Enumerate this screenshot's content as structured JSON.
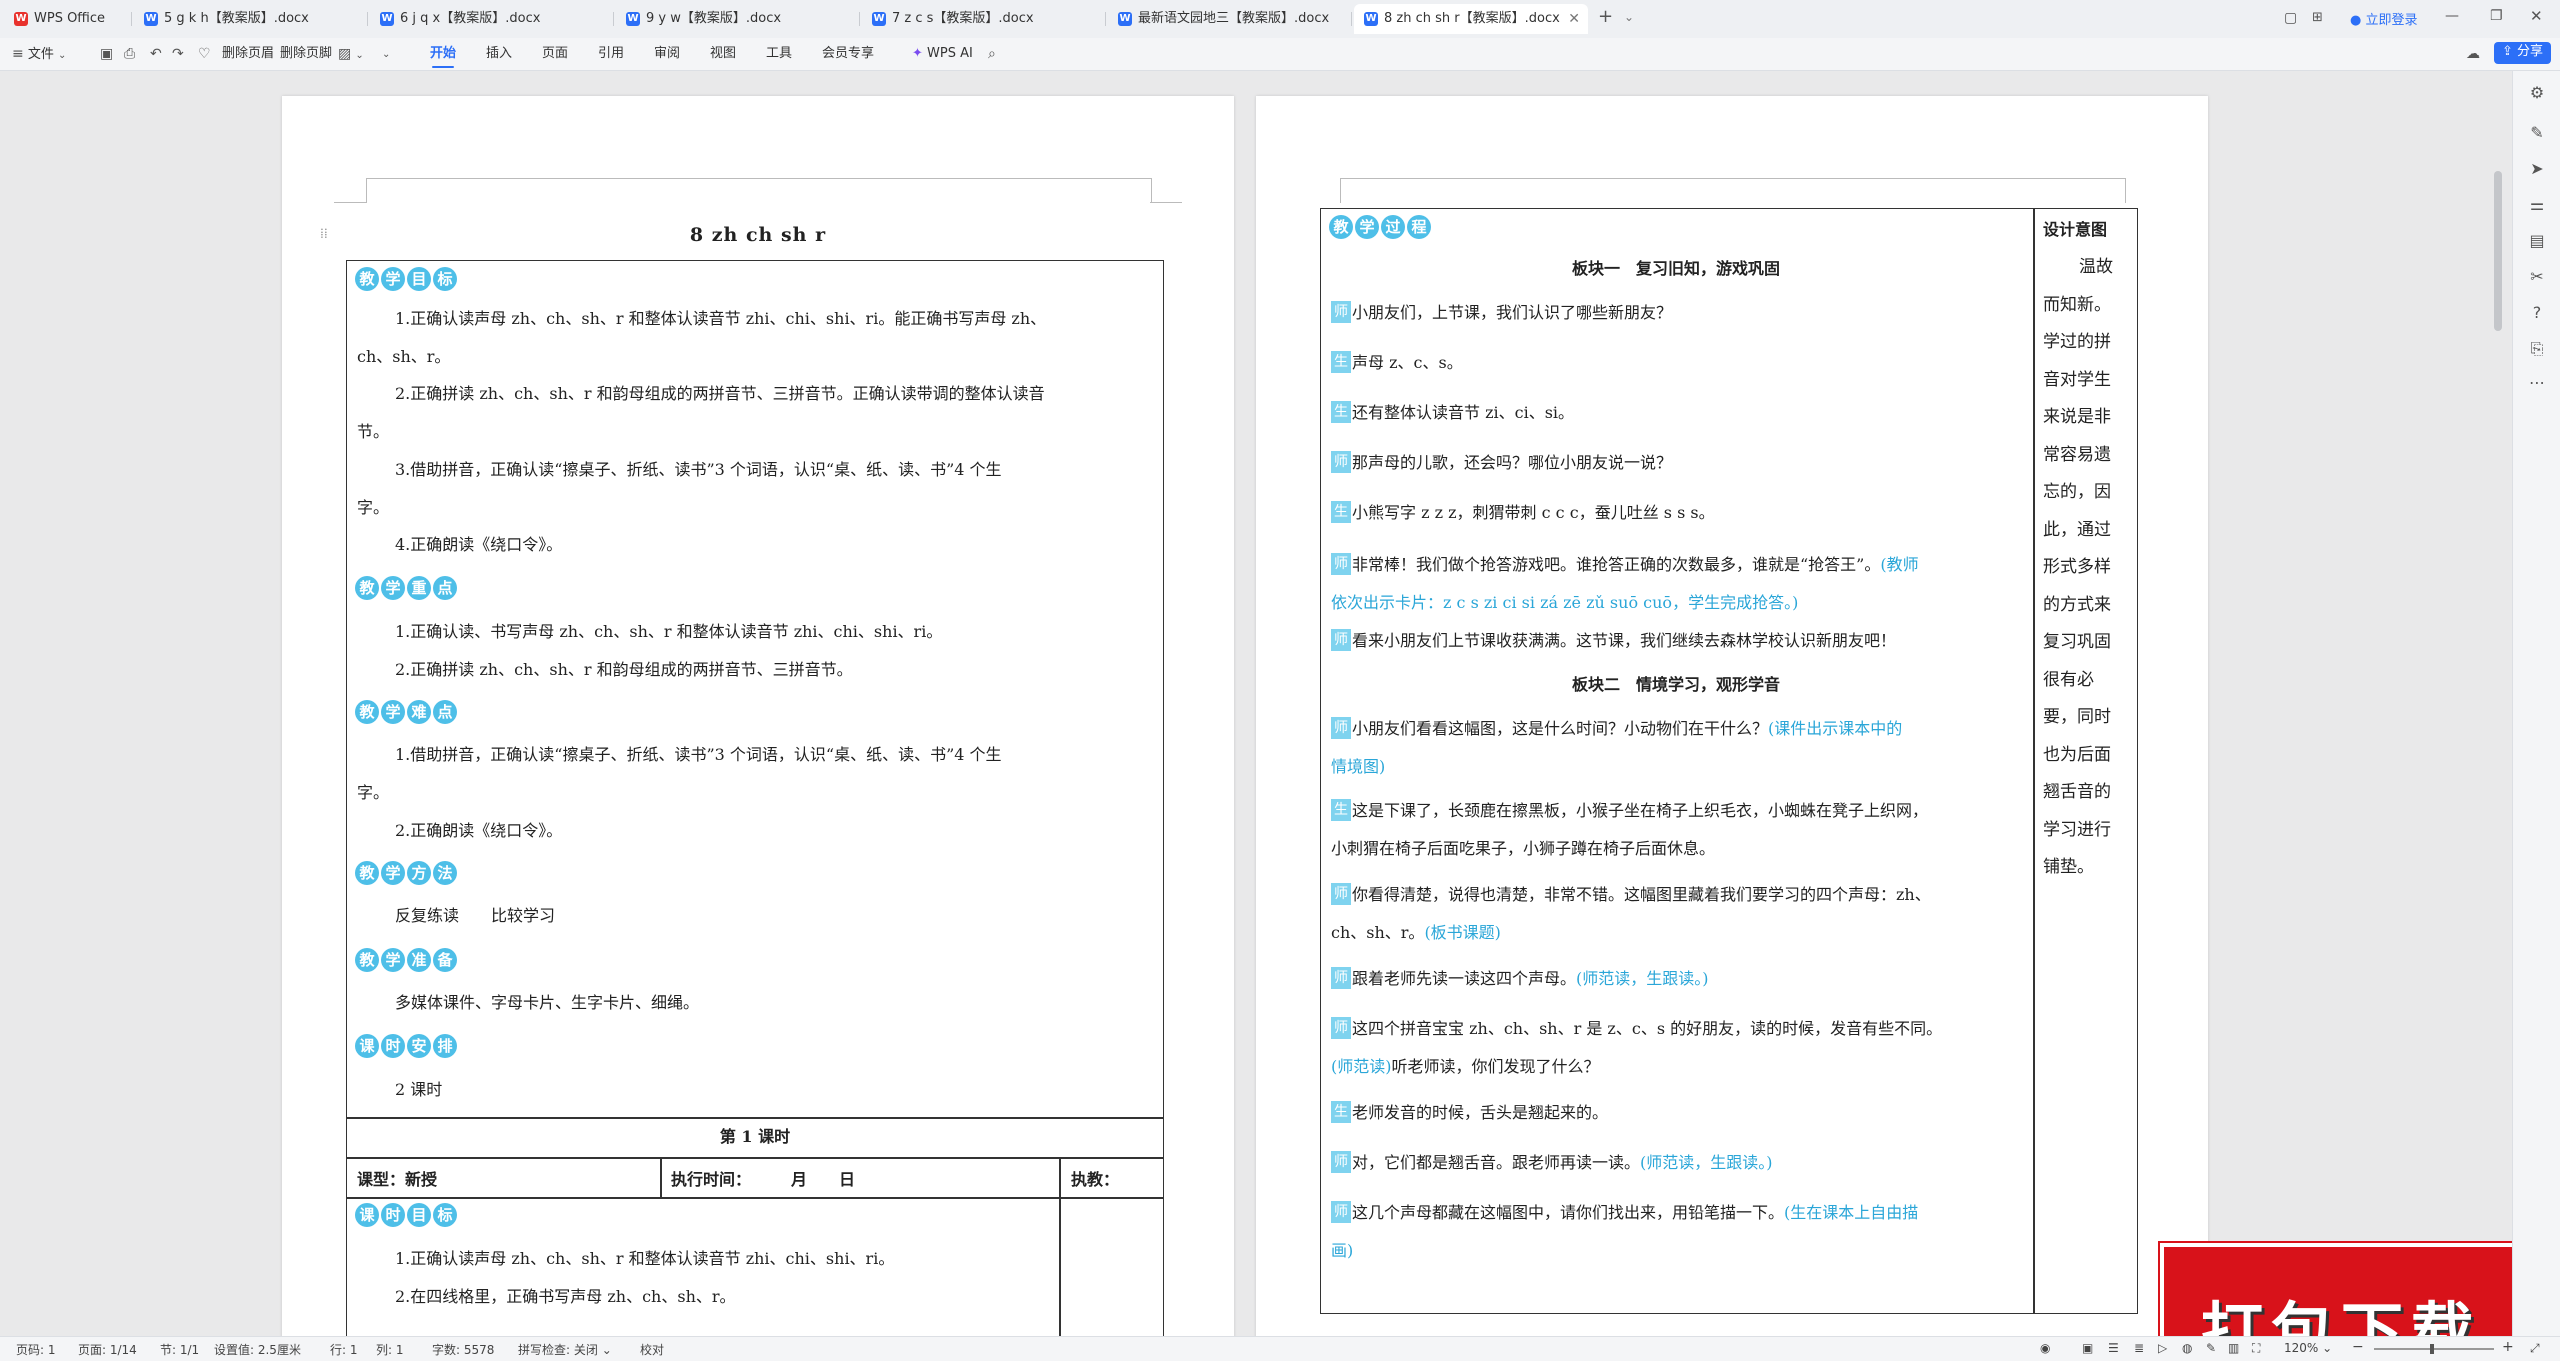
{
  "tabs": [
    {
      "label": "WPS Office",
      "icon": "wps"
    },
    {
      "label": "5 g k h【教案版】.docx",
      "icon": "W"
    },
    {
      "label": "6 j q x【教案版】.docx",
      "icon": "W"
    },
    {
      "label": "9 y w【教案版】.docx",
      "icon": "W"
    },
    {
      "label": "7 z c s【教案版】.docx",
      "icon": "W"
    },
    {
      "label": "最新语文园地三【教案版】.docx",
      "icon": "W"
    },
    {
      "label": "8 zh ch sh r【教案版】.docx",
      "icon": "W"
    }
  ],
  "titlebar": {
    "login": "立即登录",
    "share": "分享",
    "add_tab": "+"
  },
  "ribbon": {
    "file": "文件",
    "delete_page": "删除页眉",
    "delete_footer": "删除页脚",
    "menus": [
      "开始",
      "插入",
      "页面",
      "引用",
      "审阅",
      "视图",
      "工具",
      "会员专享"
    ],
    "active": "开始",
    "ai": "WPS AI"
  },
  "page1": {
    "title": "8 zh ch sh r",
    "objectives_badge": [
      "教",
      "学",
      "目",
      "标"
    ],
    "objectives": [
      "1.正确认读声母 zh、ch、sh、r 和整体认读音节 zhi、chi、shi、ri。能正确书写声母 zh、",
      "ch、sh、r。",
      "2.正确拼读 zh、ch、sh、r 和韵母组成的两拼音节、三拼音节。正确认读带调的整体认读音",
      "节。",
      "3.借助拼音，正确认读“擦桌子、折纸、读书”3 个词语，认识“桌、纸、读、书”4 个生",
      "字。",
      "4.正确朗读《绕口令》。"
    ],
    "key_badge": [
      "教",
      "学",
      "重",
      "点"
    ],
    "key": [
      "1.正确认读、书写声母 zh、ch、sh、r 和整体认读音节 zhi、chi、shi、ri。",
      "2.正确拼读 zh、ch、sh、r 和韵母组成的两拼音节、三拼音节。"
    ],
    "difficult_badge": [
      "教",
      "学",
      "难",
      "点"
    ],
    "difficult": [
      "1.借助拼音，正确认读“擦桌子、折纸、读书”3 个词语，认识“桌、纸、读、书”4 个生",
      "字。",
      "2.正确朗读《绕口令》。"
    ],
    "method_badge": [
      "教",
      "学",
      "方",
      "法"
    ],
    "method": "反复练读　　比较学习",
    "prep_badge": [
      "教",
      "学",
      "准",
      "备"
    ],
    "prep": "多媒体课件、字母卡片、生字卡片、细绳。",
    "schedule_badge": [
      "课",
      "时",
      "安",
      "排"
    ],
    "schedule": "2 课时",
    "lesson_title": "第 1 课时",
    "lesson_type": "课型：新授",
    "exec_time": "执行时间：　　　月　　日",
    "teach": "执教：",
    "lesson_obj_badge": [
      "课",
      "时",
      "目",
      "标"
    ],
    "lesson_obj": [
      "1.正确认读声母 zh、ch、sh、r 和整体认读音节 zhi、chi、shi、ri。",
      "2.在四线格里，正确书写声母 zh、ch、sh、r。"
    ]
  },
  "page2": {
    "process_badge": [
      "教",
      "学",
      "过",
      "程"
    ],
    "design_title": "设计意图",
    "design_lines": [
      "温故",
      "而知新。",
      "学过的拼",
      "音对学生",
      "来说是非",
      "常容易遗",
      "忘的，因",
      "此，通过",
      "形式多样",
      "的方式来",
      "复习巩固",
      "很有必",
      "要，同时",
      "也为后面",
      "翘舌音的",
      "学习进行",
      "铺垫。"
    ],
    "section1": "板块一　复习旧知，游戏巩固",
    "section2": "板块二　情境学习，观形学音",
    "lines": [
      {
        "tag": "师",
        "text": "小朋友们，上节课，我们认识了哪些新朋友？",
        "note": ""
      },
      {
        "tag": "生",
        "text": "声母 z、c、s。",
        "note": ""
      },
      {
        "tag": "生",
        "text": "还有整体认读音节 zi、ci、si。",
        "note": ""
      },
      {
        "tag": "师",
        "text": "那声母的儿歌，还会吗？哪位小朋友说一说？",
        "note": ""
      },
      {
        "tag": "生",
        "text": "小熊写字 z z z，刺猬带刺 c c c，蚕儿吐丝 s s s。",
        "note": ""
      },
      {
        "tag": "师",
        "text": "非常棒！我们做个抢答游戏吧。谁抢答正确的次数最多，谁就是“抢答王”。",
        "note": "(教师"
      },
      {
        "tag": "",
        "text": "",
        "note": "依次出示卡片：z c s zi ci si zá zē zǔ suō cuō，学生完成抢答。)"
      },
      {
        "tag": "师",
        "text": "看来小朋友们上节课收获满满。这节课，我们继续去森林学校认识新朋友吧！",
        "note": ""
      },
      {
        "tag": "师",
        "text": "小朋友们看看这幅图，这是什么时间？小动物们在干什么？",
        "note": "(课件出示课本中的"
      },
      {
        "tag": "",
        "text": "",
        "note": "情境图)"
      },
      {
        "tag": "生",
        "text": "这是下课了，长颈鹿在擦黑板，小猴子坐在椅子上织毛衣，小蜘蛛在凳子上织网，",
        "note": ""
      },
      {
        "tag": "",
        "text": "小刺猬在椅子后面吃果子，小狮子蹲在椅子后面休息。",
        "note": ""
      },
      {
        "tag": "师",
        "text": "你看得清楚，说得也清楚，非常不错。这幅图里藏着我们要学习的四个声母：zh、",
        "note": ""
      },
      {
        "tag": "",
        "text": "ch、sh、r。",
        "note": "(板书课题)"
      },
      {
        "tag": "师",
        "text": "跟着老师先读一读这四个声母。",
        "note": "(师范读，生跟读。)"
      },
      {
        "tag": "师",
        "text": "这四个拼音宝宝 zh、ch、sh、r 是 z、c、s 的好朋友，读的时候，发音有些不同。",
        "note": ""
      },
      {
        "tag": "",
        "text": "",
        "note": "(师范读)",
        "after": "听老师读，你们发现了什么？"
      },
      {
        "tag": "生",
        "text": "老师发音的时候，舌头是翘起来的。",
        "note": ""
      },
      {
        "tag": "师",
        "text": "对，它们都是翘舌音。跟老师再读一读。",
        "note": "(师范读，生跟读。)"
      },
      {
        "tag": "师",
        "text": "这几个声母都藏在这幅图中，请你们找出来，用铅笔描一下。",
        "note": "(生在课本上自由描"
      },
      {
        "tag": "",
        "text": "",
        "note": "画)"
      }
    ]
  },
  "status": {
    "page": "页码: 1",
    "pages": "页面: 1/14",
    "section": "节: 1/1",
    "setting": "设置值: 2.5厘米",
    "row": "行: 1",
    "col": "列: 1",
    "words": "字数: 5578",
    "spell": "拼写检查: 关闭",
    "proof": "校对",
    "zoom": "120%"
  },
  "download": "打包下载"
}
